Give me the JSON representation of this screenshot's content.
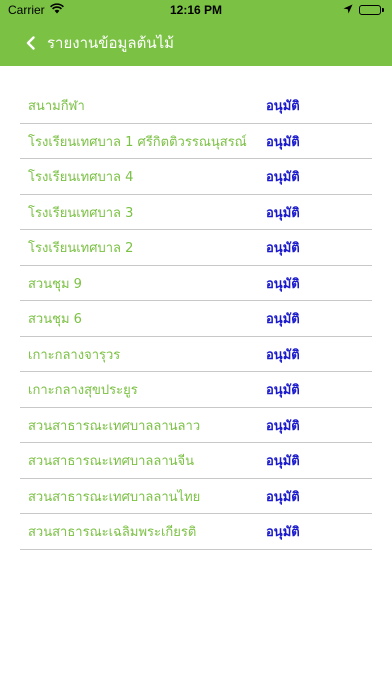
{
  "status_bar": {
    "carrier": "Carrier",
    "time": "12:16 PM"
  },
  "nav": {
    "title": "รายงานข้อมูลต้นไม้"
  },
  "colors": {
    "accent": "#7bc144",
    "status_text": "#1a1acc",
    "divider": "#c8c8c8"
  },
  "items": [
    {
      "name": "สนามกีฬา",
      "status": "อนุมัติ"
    },
    {
      "name": "โรงเรียนเทศบาล 1 ศรีกิตติวรรณนุสรณ์",
      "status": "อนุมัติ"
    },
    {
      "name": "โรงเรียนเทศบาล 4",
      "status": "อนุมัติ"
    },
    {
      "name": "โรงเรียนเทศบาล 3",
      "status": "อนุมัติ"
    },
    {
      "name": "โรงเรียนเทศบาล 2",
      "status": "อนุมัติ"
    },
    {
      "name": "สวนชุม 9",
      "status": "อนุมัติ"
    },
    {
      "name": "สวนชุม 6",
      "status": "อนุมัติ"
    },
    {
      "name": "เกาะกลางจารุวร",
      "status": "อนุมัติ"
    },
    {
      "name": "เกาะกลางสุขประยูร",
      "status": "อนุมัติ"
    },
    {
      "name": "สวนสาธารณะเทศบาลลานลาว",
      "status": "อนุมัติ"
    },
    {
      "name": "สวนสาธารณะเทศบาลลานจีน",
      "status": "อนุมัติ"
    },
    {
      "name": "สวนสาธารณะเทศบาลลานไทย",
      "status": "อนุมัติ"
    },
    {
      "name": "สวนสาธารณะเฉลิมพระเกียรติ",
      "status": "อนุมัติ"
    }
  ]
}
